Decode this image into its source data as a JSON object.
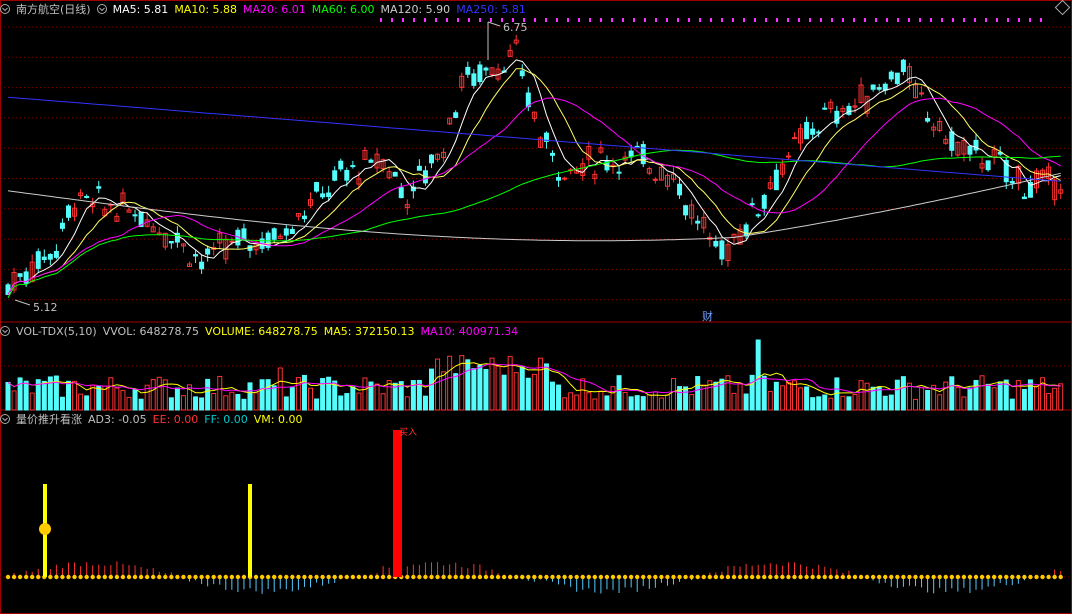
{
  "main": {
    "stock_name": "南方航空(日线)",
    "ma": [
      {
        "label": "MA5: 5.81",
        "color": "#ffffff"
      },
      {
        "label": "MA10: 5.88",
        "color": "#ffff00"
      },
      {
        "label": "MA20: 6.01",
        "color": "#ff00ff"
      },
      {
        "label": "MA60: 6.00",
        "color": "#00ff00"
      },
      {
        "label": "MA120: 5.90",
        "color": "#cccccc"
      },
      {
        "label": "MA250: 5.81",
        "color": "#3333ff"
      }
    ],
    "high_label": "6.75",
    "low_label": "5.12",
    "marker": "财"
  },
  "volume": {
    "title": "VOL-TDX(5,10)",
    "items": [
      {
        "label": "VVOL: 648278.75",
        "color": "#c0c0c0"
      },
      {
        "label": "VOLUME: 648278.75",
        "color": "#ffff00"
      },
      {
        "label": "MA5: 372150.13",
        "color": "#ffff00"
      },
      {
        "label": "MA10: 400971.34",
        "color": "#ff00ff"
      }
    ]
  },
  "indicator": {
    "title": "量价推升看涨",
    "items": [
      {
        "label": "AD3: -0.05",
        "color": "#c0c0c0"
      },
      {
        "label": "EE: 0.00",
        "color": "#ff3333"
      },
      {
        "label": "FF: 0.00",
        "color": "#00cccc"
      },
      {
        "label": "VM: 0.00",
        "color": "#ffff00"
      }
    ],
    "signal": "买入"
  },
  "colors": {
    "up": "#ff3232",
    "down": "#54fcfc",
    "ma5": "#ffffff",
    "ma10": "#ffff00",
    "ma20": "#ff00ff",
    "ma60": "#00ff00",
    "ma120": "#cccccc",
    "ma250": "#3333ff",
    "grid": "#800000",
    "border": "#a00000"
  }
}
